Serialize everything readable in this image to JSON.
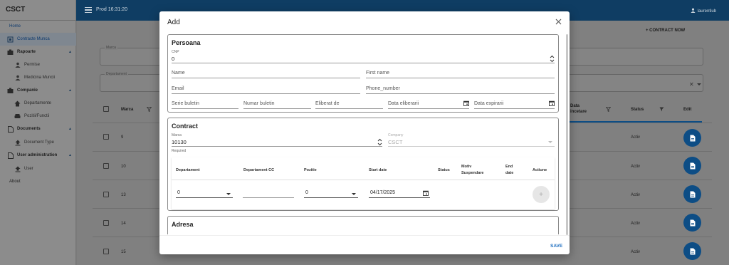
{
  "app": {
    "name": "CSCT"
  },
  "sidebar": {
    "items": [
      {
        "label": "Home"
      },
      {
        "label": "Contracte Munca"
      },
      {
        "label": "Rapoarte"
      },
      {
        "label": "Permise"
      },
      {
        "label": "Medicina Muncii"
      },
      {
        "label": "Companie"
      },
      {
        "label": "Departamente"
      },
      {
        "label": "Pozitii/Functii"
      },
      {
        "label": "Documents"
      },
      {
        "label": "Document Type"
      },
      {
        "label": "User administration"
      },
      {
        "label": "User"
      },
      {
        "label": "About"
      }
    ]
  },
  "topbar": {
    "title": "Prod 16:31:20",
    "user": "laurentiub"
  },
  "page": {
    "add_contract_label": "+ CONTRACT NOW",
    "filter_marca_label": "Marca",
    "filter_departament_label": "Departament",
    "columns": {
      "marca": "Marca",
      "data_incetare": "Data incetare",
      "status": "Status",
      "edit": "Edit"
    },
    "rows": [
      {
        "marca": "9",
        "status": "Activ"
      },
      {
        "marca": "10",
        "status": "Activ"
      },
      {
        "marca": "13",
        "status": "Activ"
      },
      {
        "marca": "14",
        "status": "Activ"
      },
      {
        "marca": "15",
        "status": "Activ"
      }
    ]
  },
  "modal": {
    "title": "Add",
    "save_label": "SAVE",
    "persoana": {
      "title": "Persoana",
      "cnp_label": "CNP",
      "cnp_value": "0",
      "name_label": "Name",
      "first_name_label": "First name",
      "email_label": "Email",
      "phone_label": "Phone_number",
      "serie_label": "Serie buletin",
      "numar_label": "Numar buletin",
      "eliberat_label": "Eliberat de",
      "data_eliberarii_label": "Data eliberarii",
      "data_expirarii_label": "Data expirarii"
    },
    "contract": {
      "title": "Contract",
      "marca_label": "Marca",
      "marca_value": "10130",
      "required_text": "Required",
      "company_label": "Company",
      "company_value": "CSCT",
      "headers": {
        "departament": "Departament",
        "departament_cc": "Departament CC",
        "pozitie": "Pozitie",
        "start_date": "Start date",
        "status": "Status",
        "motiv": "Motiv Suspendare",
        "end_date": "End date",
        "actiune": "Actiune"
      },
      "row": {
        "departament": "0",
        "pozitie": "0",
        "start_date": "04/17/2025"
      }
    },
    "adresa": {
      "title": "Adresa"
    }
  },
  "colors": {
    "primary": "#0d4d85",
    "topbar": "#0f3d63"
  }
}
